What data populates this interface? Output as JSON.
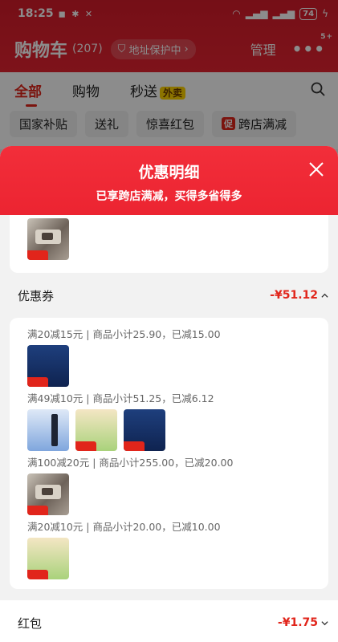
{
  "status": {
    "time": "18:25",
    "battery": "74"
  },
  "header": {
    "title": "购物车",
    "count": "(207)",
    "address_pill": "地址保护中",
    "manage": "管理",
    "more_badge": "5+"
  },
  "tabs": [
    {
      "label": "全部",
      "active": true
    },
    {
      "label": "购物",
      "active": false
    },
    {
      "label": "秒送",
      "tag": "外卖",
      "active": false
    }
  ],
  "chips": [
    "国家补贴",
    "送礼",
    "惊喜红包",
    "跨店满减"
  ],
  "chip_promo_mark": "促",
  "sheet": {
    "title": "优惠明细",
    "subtitle": "已享跨店满减，买得多省得多"
  },
  "coupon_section": {
    "label": "优惠券",
    "amount": "-¥51.12",
    "lines": [
      {
        "text": "满20减15元 | 商品小计25.90，已减15.00",
        "thumbs": [
          "book-dark-blue"
        ]
      },
      {
        "text": "满49减10元 | 商品小计51.25，已减6.12",
        "thumbs": [
          "pen-box-blue",
          "snack-bag-green",
          "book-dark-blue"
        ]
      },
      {
        "text": "满100减20元 | 商品小计255.00，已减20.00",
        "thumbs": [
          "device-silver"
        ]
      },
      {
        "text": "满20减10元 | 商品小计20.00，已减10.00",
        "thumbs": [
          "snack-bag-green"
        ]
      }
    ]
  },
  "redpacket_section": {
    "label": "红包",
    "amount": "-¥1.75"
  },
  "colors": {
    "brand_red": "#e1251b",
    "header_red": "#ec2431",
    "tag_yellow": "#ffd400"
  }
}
